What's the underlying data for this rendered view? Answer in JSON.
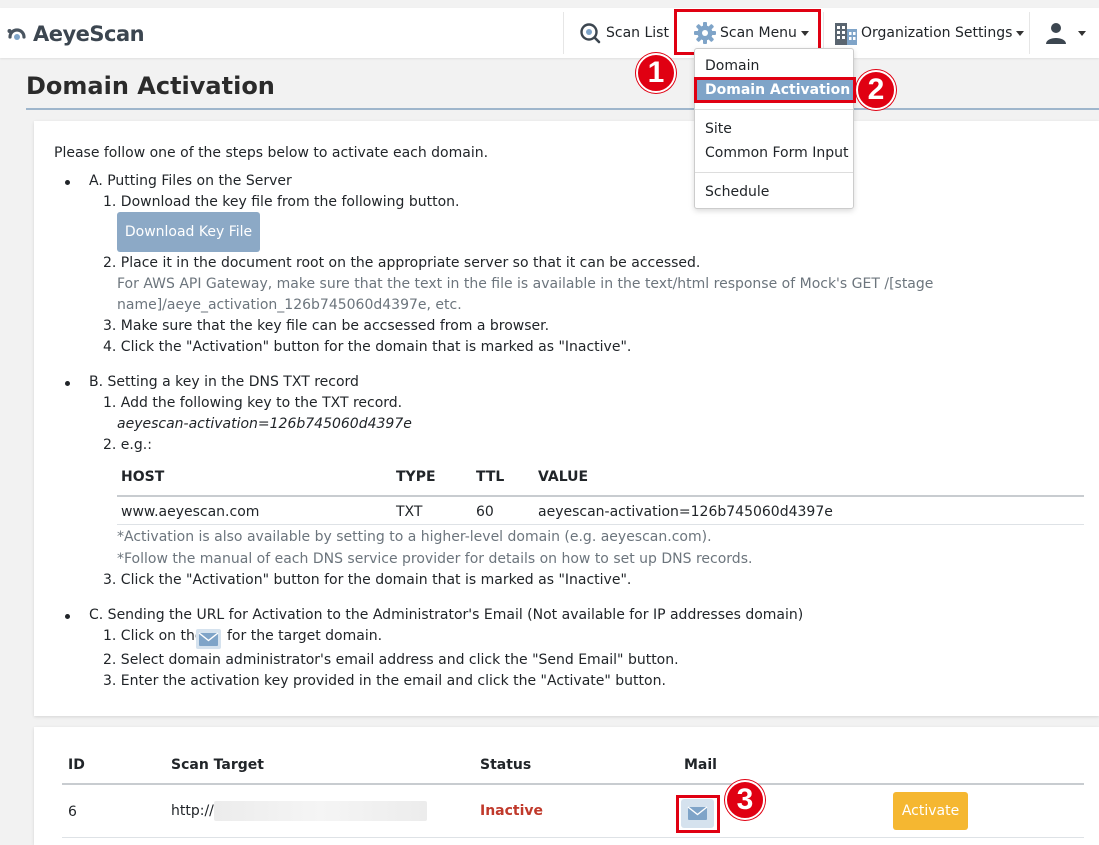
{
  "navbar": {
    "brand": "AeyeScan",
    "scan_list": "Scan List",
    "scan_menu": "Scan Menu",
    "org_settings": "Organization Settings"
  },
  "dropdown": {
    "items": [
      "Domain",
      "Domain Activation",
      "Site",
      "Common Form Input",
      "Schedule"
    ],
    "active": "Domain Activation"
  },
  "callouts": [
    "1",
    "2",
    "3"
  ],
  "page": {
    "title": "Domain Activation",
    "intro": "Please follow one of the steps below to activate each domain."
  },
  "section_a": {
    "title": "A. Putting Files on the Server",
    "step1": "1. Download the key file from the following button.",
    "button": "Download Key File",
    "step2": "2. Place it in the document root on the appropriate server so that it can be accessed.",
    "note_line1": "For AWS API Gateway, make sure that the text in the file is available in the text/html response of Mock's GET /[stage",
    "note_line2": "name]/aeye_activation_126b745060d4397e, etc.",
    "step3": "3. Make sure that the key file can be accsessed from a browser.",
    "step4": "4. Click the \"Activation\" button for the domain that is marked as \"Inactive\"."
  },
  "section_b": {
    "title": "B. Setting a key in the DNS TXT record",
    "step1": "1. Add the following key to the TXT record.",
    "key": "aeyescan-activation=126b745060d4397e",
    "step2": "2. e.g.:",
    "table": {
      "headers": [
        "HOST",
        "TYPE",
        "TTL",
        "VALUE"
      ],
      "row": [
        "www.aeyescan.com",
        "TXT",
        "60",
        "aeyescan-activation=126b745060d4397e"
      ]
    },
    "note1": "*Activation is also available by setting to a higher-level domain (e.g. aeyescan.com).",
    "note2": "*Follow the manual of each DNS service provider for details on how to set up DNS records.",
    "step3": "3. Click the \"Activation\" button for the domain that is marked as \"Inactive\"."
  },
  "section_c": {
    "title": "C. Sending the URL for Activation to the Administrator's Email (Not available for IP addresses domain)",
    "step1_pre": "1. Click on the",
    "step1_post": "for the target domain.",
    "step2": "2. Select domain administrator's email address and click the \"Send Email\" button.",
    "step3": "3. Enter the activation key provided in the email and click the \"Activate\" button."
  },
  "domains_table": {
    "headers": [
      "ID",
      "Scan Target",
      "Status",
      "Mail"
    ],
    "rows": [
      {
        "id": "6",
        "target": "http://",
        "status": "Inactive",
        "action": "Activate"
      }
    ]
  },
  "colors": {
    "accent": "#7fa4c8",
    "highlight": "#e00012",
    "inactive": "#c0392b",
    "activate": "#f5b731"
  }
}
